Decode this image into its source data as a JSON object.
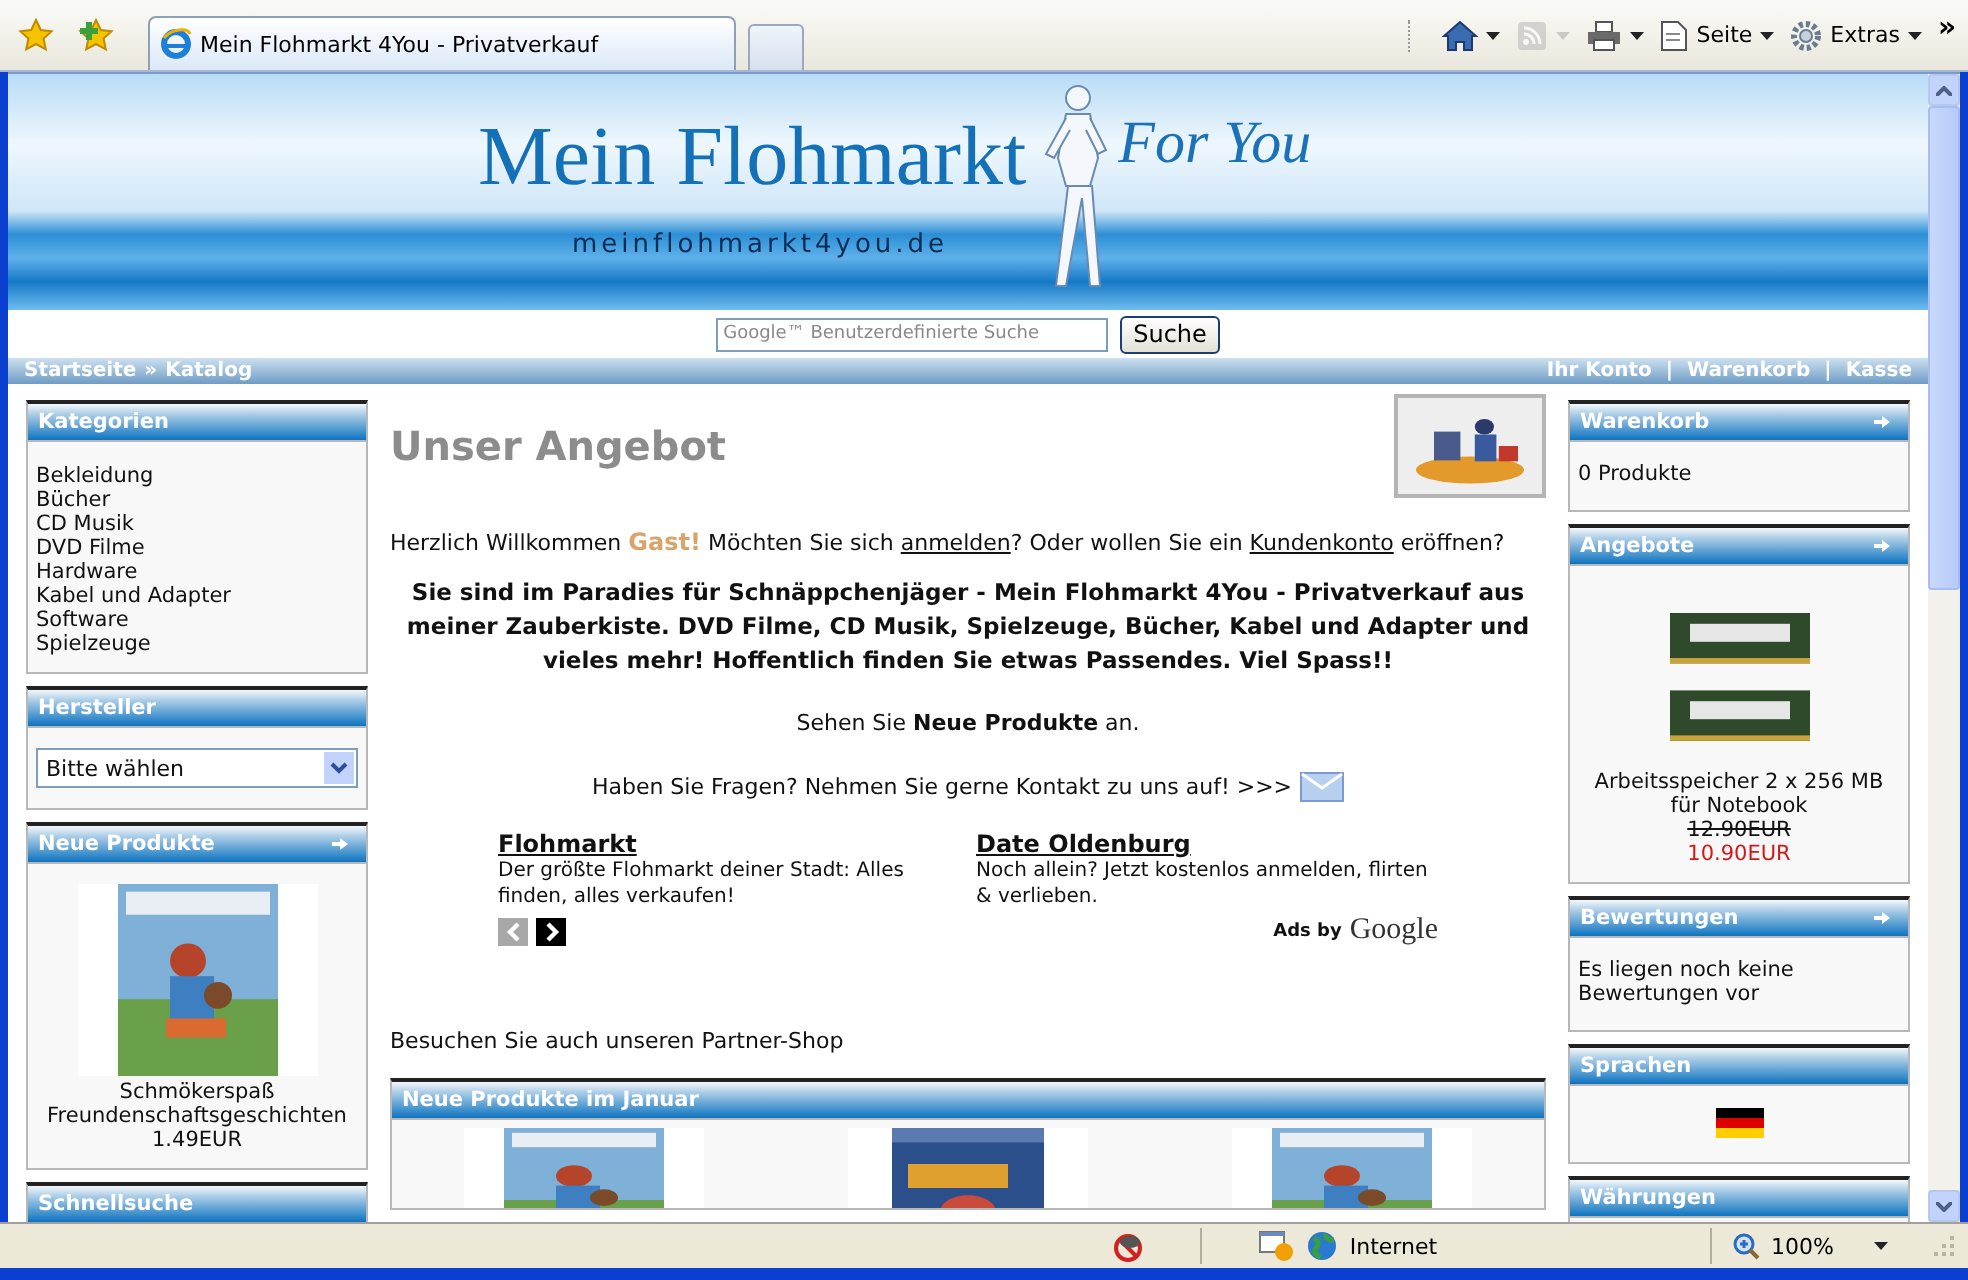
{
  "browser": {
    "tab_title": "Mein Flohmarkt 4You - Privatverkauf",
    "commands": [
      {
        "kind": "home",
        "disabled": false
      },
      {
        "kind": "feeds",
        "disabled": true
      },
      {
        "kind": "print",
        "disabled": false
      },
      {
        "kind": "page",
        "label": "Seite",
        "disabled": false
      },
      {
        "kind": "tools",
        "label": "Extras",
        "disabled": false
      }
    ],
    "overflow": "»"
  },
  "header": {
    "title": "Mein Flohmarkt",
    "tagline": "For You",
    "domain": "meinflohmarkt4you.de"
  },
  "search": {
    "placeholder": "Google™ Benutzerdefinierte Suche",
    "button": "Suche"
  },
  "nav": {
    "breadcrumb": [
      "Startseite",
      "Katalog"
    ],
    "breadcrumb_separator": "»",
    "links": [
      "Ihr Konto",
      "Warenkorb",
      "Kasse"
    ],
    "link_separator": "|"
  },
  "left_column": [
    {
      "kind": "list",
      "title": "Kategorien",
      "more": false,
      "items": [
        "Bekleidung",
        "Bücher",
        "CD Musik",
        "DVD Filme",
        "Hardware",
        "Kabel und Adapter",
        "Software",
        "Spielzeuge"
      ]
    },
    {
      "kind": "select",
      "title": "Hersteller",
      "more": false,
      "value": "Bitte wählen"
    },
    {
      "kind": "product",
      "title": "Neue Produkte",
      "more": true,
      "name": "Schmökerspaß Freundenschaftsgeschichten",
      "price": "1.49EUR"
    },
    {
      "kind": "empty",
      "title": "Schnellsuche",
      "more": false
    }
  ],
  "main": {
    "heading": "Unser Angebot",
    "welcome": [
      {
        "kind": "text",
        "text": "Herzlich Willkommen "
      },
      {
        "kind": "guest",
        "text": "Gast!"
      },
      {
        "kind": "text",
        "text": " Möchten Sie sich "
      },
      {
        "kind": "link",
        "text": "anmelden"
      },
      {
        "kind": "text",
        "text": "? Oder wollen Sie ein "
      },
      {
        "kind": "link",
        "text": "Kundenkonto"
      },
      {
        "kind": "text",
        "text": " eröffnen?"
      }
    ],
    "intro": "Sie sind im Paradies für Schnäppchenjäger - Mein Flohmarkt 4You - Privatverkauf aus meiner Zauberkiste. DVD Filme, CD Musik, Spielzeuge, Bücher, Kabel und Adapter und vieles mehr! Hoffentlich finden Sie etwas Passendes. Viel Spass!!",
    "new_products_line": "Sehen Sie **Neue Produkte** an.",
    "contact_line": "Haben Sie Fragen? Nehmen Sie gerne Kontakt zu uns auf! >>>",
    "ads": {
      "items": [
        {
          "title": "Flohmarkt",
          "text": "Der größte Flohmarkt deiner Stadt: Alles finden, alles verkaufen!"
        },
        {
          "title": "Date Oldenburg",
          "text": "Noch allein? Jetzt kostenlos anmelden, flirten & verlieben."
        }
      ],
      "prev": {
        "disabled": true
      },
      "next": {
        "disabled": false
      },
      "by": "Ads by",
      "brand": "Google"
    },
    "partner_line": "Besuchen Sie auch unseren Partner-Shop",
    "new_box": {
      "title": "Neue Produkte im Januar",
      "products": [
        {
          "kind": "book"
        },
        {
          "kind": "cd"
        },
        {
          "kind": "book"
        }
      ]
    }
  },
  "right_column": [
    {
      "kind": "text",
      "title": "Warenkorb",
      "more": true,
      "text": "0 Produkte"
    },
    {
      "kind": "offer",
      "title": "Angebote",
      "more": true,
      "name": "Arbeitsspeicher 2 x 256 MB für Notebook",
      "old_price": "12.90EUR",
      "price": "10.90EUR"
    },
    {
      "kind": "text",
      "title": "Bewertungen",
      "more": true,
      "text": "Es liegen noch keine Bewertungen vor"
    },
    {
      "kind": "language",
      "title": "Sprachen",
      "more": false
    },
    {
      "kind": "empty",
      "title": "Währungen",
      "more": false
    }
  ],
  "status_bar": {
    "zone": "Internet",
    "zoom": "100%"
  }
}
